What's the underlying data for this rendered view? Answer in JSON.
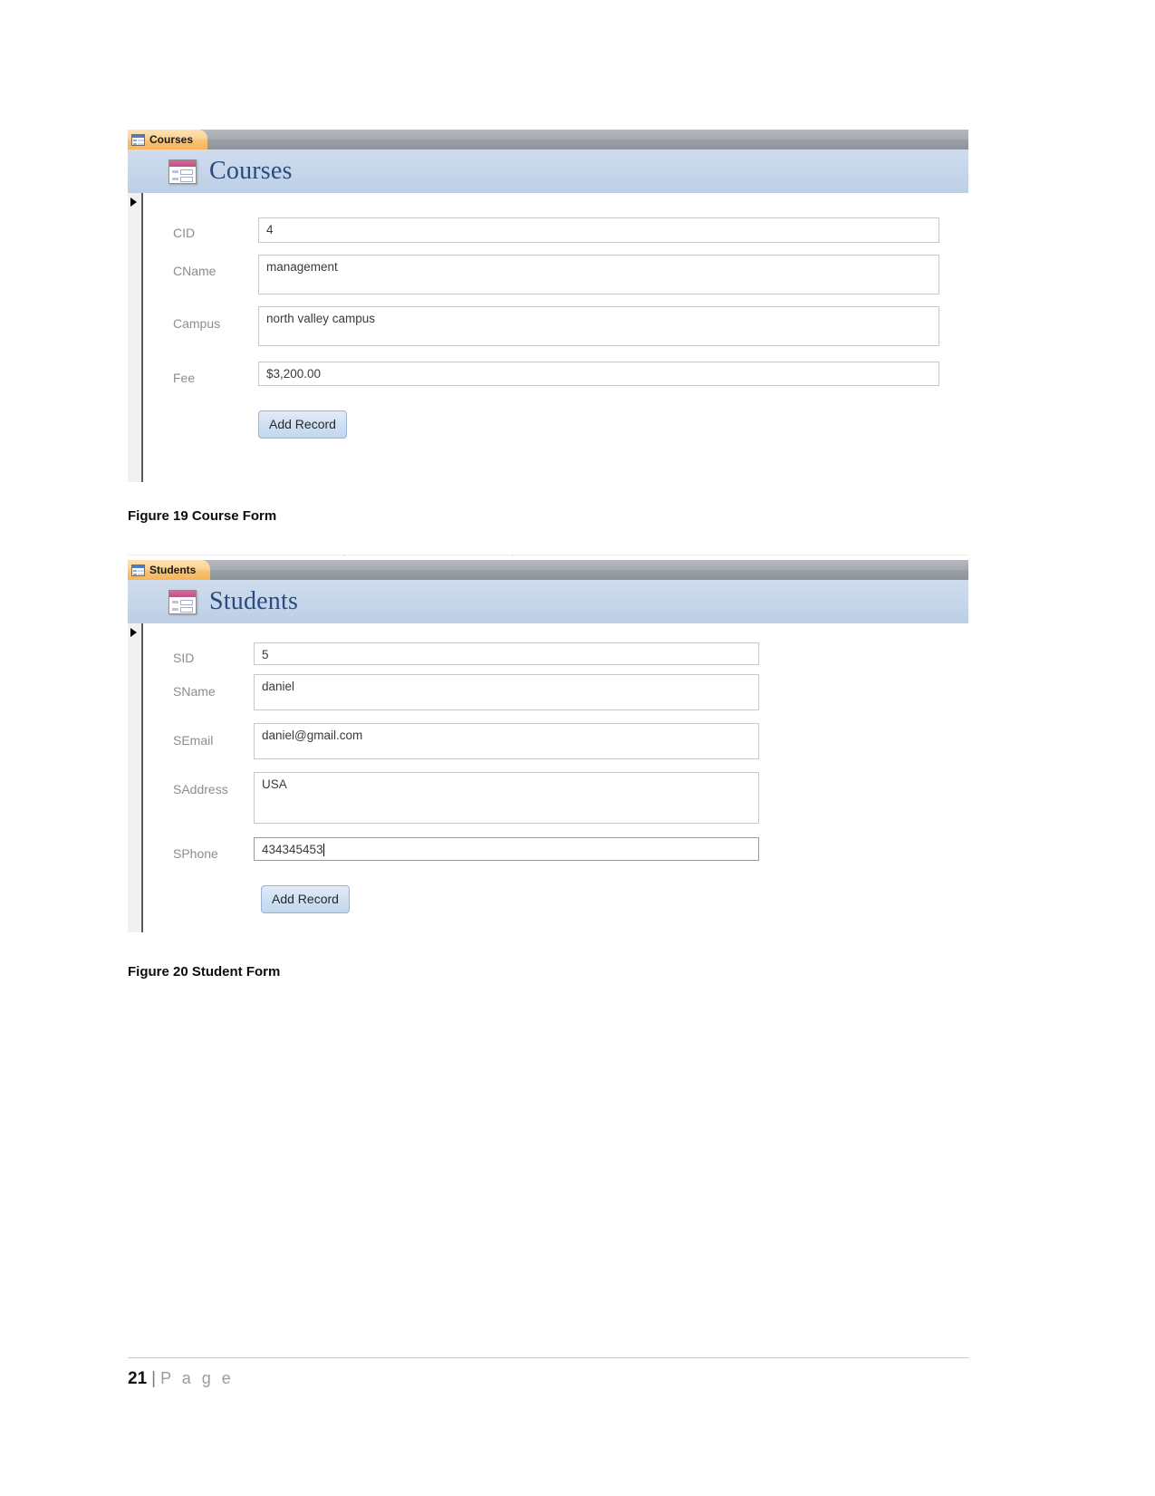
{
  "document": {
    "footer": {
      "page_number": "21",
      "separator": "|",
      "page_word": "P a g e"
    }
  },
  "figures": [
    {
      "caption": "Figure 19 Course Form",
      "form": {
        "tab_label": "Courses",
        "title": "Courses",
        "tab_icon": "form-icon",
        "header_icon": "form-icon",
        "record_selector_icon": "record-selector-arrow-icon",
        "fields": [
          {
            "label": "CID",
            "value": "4",
            "focused": false
          },
          {
            "label": "CName",
            "value": "management",
            "focused": false
          },
          {
            "label": "Campus",
            "value": "north valley campus",
            "focused": false
          },
          {
            "label": "Fee",
            "value": "$3,200.00",
            "focused": false
          }
        ],
        "button_label": "Add Record"
      }
    },
    {
      "caption": "Figure 20 Student Form",
      "form": {
        "tab_label": "Students",
        "title": "Students",
        "tab_icon": "form-icon",
        "header_icon": "form-icon",
        "record_selector_icon": "record-selector-arrow-icon",
        "fields": [
          {
            "label": "SID",
            "value": "5",
            "focused": false
          },
          {
            "label": "SName",
            "value": "daniel",
            "focused": false
          },
          {
            "label": "SEmail",
            "value": "daniel@gmail.com",
            "focused": false
          },
          {
            "label": "SAddress",
            "value": "USA",
            "focused": false
          },
          {
            "label": "SPhone",
            "value": "434345453",
            "focused": true
          }
        ],
        "button_label": "Add Record"
      }
    }
  ],
  "colors": {
    "tabbar_gray": "#a7acb2",
    "tab_orange": "#f8c172",
    "header_blue": "#c6d6ea",
    "title_blue": "#2b4b7e",
    "icon_pink": "#c44d86",
    "button_blue": "#cfe0f2",
    "label_gray": "#8d8d8d"
  }
}
